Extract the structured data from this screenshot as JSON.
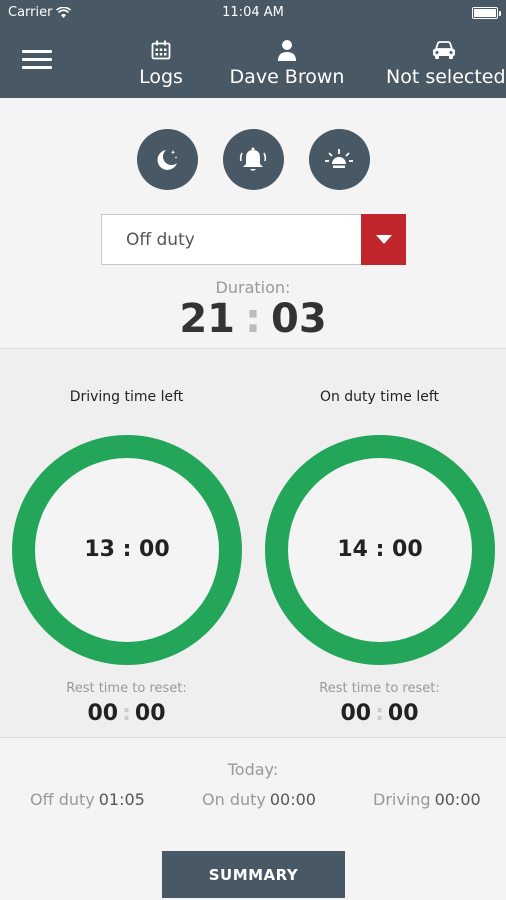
{
  "status_bar": {
    "carrier": "Carrier",
    "time": "11:04 AM"
  },
  "nav": {
    "logs": {
      "label": "Logs",
      "icon": "calendar-icon"
    },
    "driver": {
      "label": "Dave Brown",
      "icon": "person-icon"
    },
    "vehicle": {
      "label": "Not selected",
      "icon": "car-icon"
    }
  },
  "status_buttons": [
    "moon-icon",
    "bell-icon",
    "lamp-icon"
  ],
  "duty_select": {
    "value": "Off duty"
  },
  "duration": {
    "label": "Duration:",
    "hours": "21",
    "minutes": "03"
  },
  "driving": {
    "title": "Driving time left",
    "value": "13 : 00",
    "rest_label": "Rest time to reset:",
    "rest_h": "00",
    "rest_m": "00"
  },
  "on_duty": {
    "title": "On duty time left",
    "value": "14 : 00",
    "rest_label": "Rest time to reset:",
    "rest_h": "00",
    "rest_m": "00"
  },
  "today": {
    "label": "Today:",
    "off_duty": {
      "label": "Off duty",
      "value": "01:05"
    },
    "on_duty": {
      "label": "On duty",
      "value": "00:00"
    },
    "driving": {
      "label": "Driving",
      "value": "00:00"
    }
  },
  "summary_button": "SUMMARY",
  "colors": {
    "header": "#485864",
    "ring": "#23a55a",
    "accent_red": "#c0262b"
  }
}
